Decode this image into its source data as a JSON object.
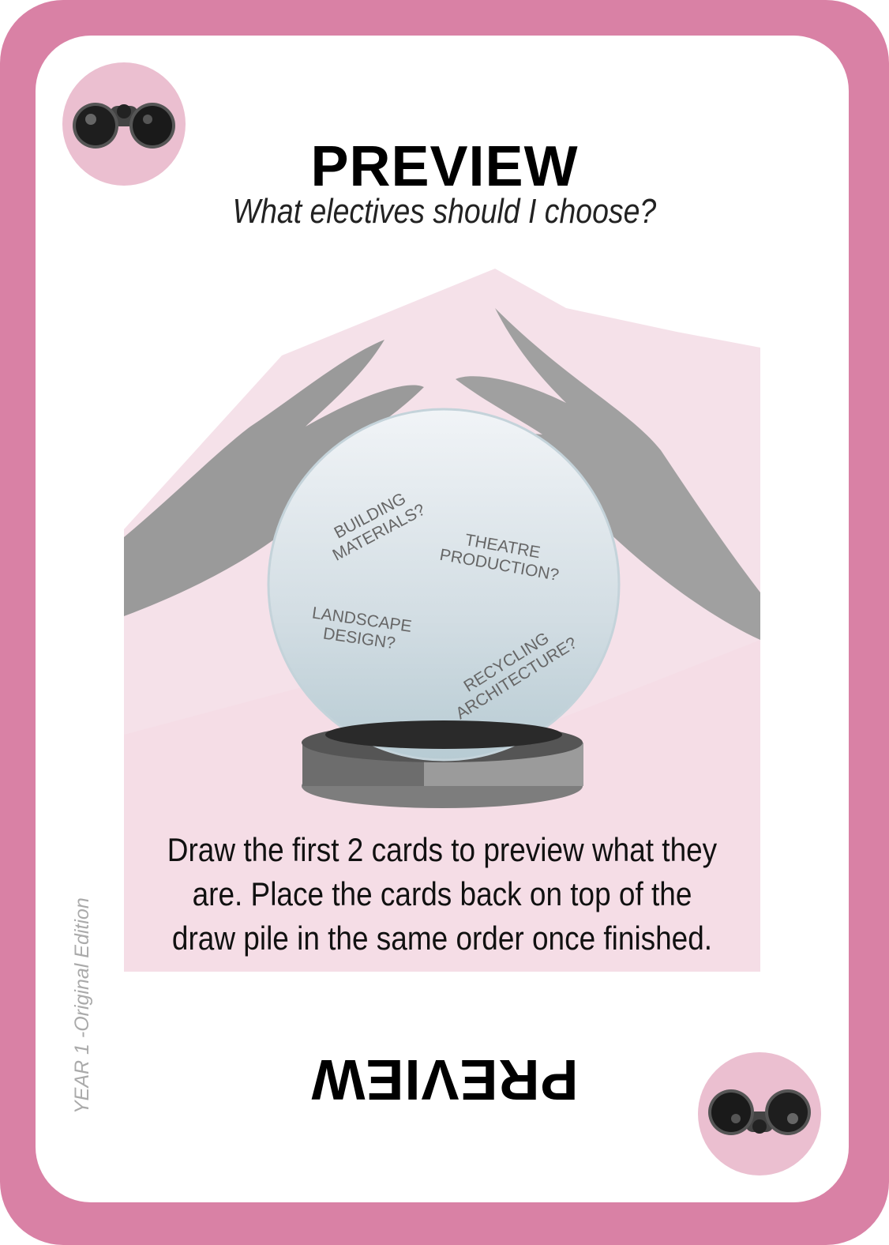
{
  "card": {
    "title": "PREVIEW",
    "subtitle": "What electives should I choose?",
    "ball_labels": [
      {
        "line1": "BUILDING",
        "line2": "MATERIALS?"
      },
      {
        "line1": "THEATRE",
        "line2": "PRODUCTION?"
      },
      {
        "line1": "LANDSCAPE",
        "line2": "DESIGN?"
      },
      {
        "line1": "RECYCLING",
        "line2": "ARCHITECTURE?"
      }
    ],
    "instructions": "Draw the first 2 cards to preview what they are. Place the cards back on top of the draw pile in the same order once finished.",
    "edition": "YEAR 1 -Original Edition",
    "icon": "binoculars-icon",
    "colors": {
      "border": "#d981a5",
      "badge": "#ebbfd0",
      "wash": "#f3d9e3"
    }
  }
}
